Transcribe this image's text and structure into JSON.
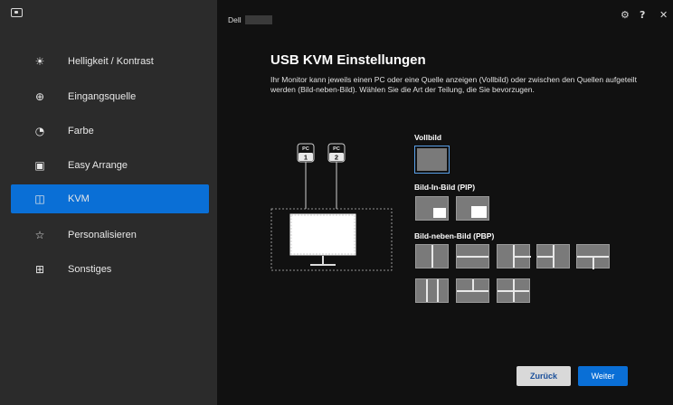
{
  "header": {
    "brand": "Dell",
    "icons": [
      "settings-icon",
      "help-icon",
      "close-icon"
    ]
  },
  "sidebar": {
    "items": [
      {
        "label": "Helligkeit / Kontrast",
        "icon": "brightness-icon",
        "active": false
      },
      {
        "label": "Eingangsquelle",
        "icon": "input-source-icon",
        "active": false
      },
      {
        "label": "Farbe",
        "icon": "color-icon",
        "active": false
      },
      {
        "label": "Easy Arrange",
        "icon": "easy-arrange-icon",
        "active": false
      },
      {
        "label": "KVM",
        "icon": "kvm-icon",
        "active": true
      },
      {
        "label": "Personalisieren",
        "icon": "star-icon",
        "active": false
      },
      {
        "label": "Sonstiges",
        "icon": "others-icon",
        "active": false
      }
    ]
  },
  "main": {
    "title": "USB KVM Einstellungen",
    "description": "Ihr Monitor kann jeweils einen PC oder eine Quelle anzeigen (Vollbild) oder zwischen den Quellen aufgeteilt werden (Bild-neben-Bild). Wählen Sie die Art der Teilung, die Sie bevorzugen.",
    "diagram": {
      "pc1_label": "PC",
      "pc1_number": "1",
      "pc2_label": "PC",
      "pc2_number": "2"
    },
    "sections": {
      "vollbild": "Vollbild",
      "pip": "Bild-In-Bild (PIP)",
      "pbp": "Bild-neben-Bild (PBP)"
    },
    "selected_layout": "vollbild"
  },
  "footer": {
    "back_label": "Zurück",
    "next_label": "Weiter"
  },
  "colors": {
    "accent": "#0a6fd6",
    "sidebar_bg": "#2b2b2b",
    "main_bg": "#111111",
    "thumb_bg": "#7a7a7a"
  }
}
